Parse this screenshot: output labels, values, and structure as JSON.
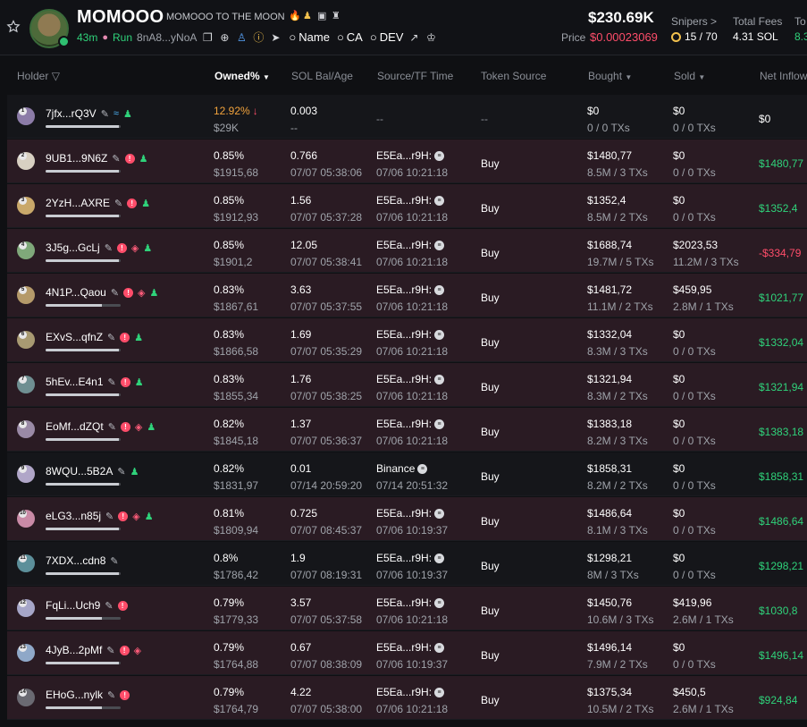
{
  "token": {
    "title": "MOMOOO",
    "subtitle": "MOMOOO TO THE MOON",
    "age": "43m",
    "run_label": "Run",
    "ca_short": "8nA8...yNoA",
    "links": {
      "name": "Name",
      "ca": "CA",
      "dev": "DEV"
    },
    "market_cap": "$230.69K",
    "price_label": "Price",
    "price_value": "$0.00023069",
    "snipers_label": "Snipers >",
    "snipers_value": "15 / 70",
    "fees_label": "Total Fees",
    "fees_value": "4.31 SOL",
    "to_label": "To",
    "to_value": "8.3"
  },
  "columns": {
    "holder": "Holder",
    "owned": "Owned%",
    "sol_bal": "SOL Bal/Age",
    "source": "Source/TF Time",
    "token_source": "Token Source",
    "bought": "Bought",
    "sold": "Sold",
    "net_inflow": "Net Inflow"
  },
  "rows": [
    {
      "rank": "1",
      "holder": "7jfx...rQ3V",
      "badges": [
        "swim",
        "user"
      ],
      "bar": 0.98,
      "owned": "12.92%",
      "owned_usd": "$29K",
      "sol": "0.003",
      "age": "--",
      "source": "--",
      "tf_time": "",
      "token_source": "--",
      "bought": "$0",
      "bought_tx": "0 / 0 TXs",
      "sold": "$0",
      "sold_tx": "0 / 0 TXs",
      "inflow": "$0",
      "style": "dark",
      "highlight": true
    },
    {
      "rank": "2",
      "holder": "9UB1...9N6Z",
      "badges": [
        "warn",
        "user"
      ],
      "bar": 0.98,
      "owned": "0.85%",
      "owned_usd": "$1915,68",
      "sol": "0.766",
      "age": "07/07 05:38:06",
      "source": "E5Ea...r9H:",
      "tf_time": "07/06 10:21:18",
      "token_source": "Buy",
      "bought": "$1480,77",
      "bought_tx": "8.5M / 3 TXs",
      "sold": "$0",
      "sold_tx": "0 / 0 TXs",
      "inflow": "$1480,77",
      "style": "pink"
    },
    {
      "rank": "3",
      "holder": "2YzH...AXRE",
      "badges": [
        "warn",
        "user"
      ],
      "bar": 0.98,
      "owned": "0.85%",
      "owned_usd": "$1912,93",
      "sol": "1.56",
      "age": "07/07 05:37:28",
      "source": "E5Ea...r9H:",
      "tf_time": "07/06 10:21:18",
      "token_source": "Buy",
      "bought": "$1352,4",
      "bought_tx": "8.5M / 2 TXs",
      "sold": "$0",
      "sold_tx": "0 / 0 TXs",
      "inflow": "$1352,4",
      "style": "pink"
    },
    {
      "rank": "4",
      "holder": "3J5g...GcLj",
      "badges": [
        "warn",
        "layer",
        "user"
      ],
      "bar": 0.98,
      "owned": "0.85%",
      "owned_usd": "$1901,2",
      "sol": "12.05",
      "age": "07/07 05:38:41",
      "source": "E5Ea...r9H:",
      "tf_time": "07/06 10:21:18",
      "token_source": "Buy",
      "bought": "$1688,74",
      "bought_tx": "19.7M / 5 TXs",
      "sold": "$2023,53",
      "sold_tx": "11.2M / 3 TXs",
      "inflow": "-$334,79",
      "style": "pink",
      "neg": true
    },
    {
      "rank": "5",
      "holder": "4N1P...Qaou",
      "badges": [
        "warn",
        "layer",
        "user"
      ],
      "bar": 0.75,
      "owned": "0.83%",
      "owned_usd": "$1867,61",
      "sol": "3.63",
      "age": "07/07 05:37:55",
      "source": "E5Ea...r9H:",
      "tf_time": "07/06 10:21:18",
      "token_source": "Buy",
      "bought": "$1481,72",
      "bought_tx": "11.1M / 2 TXs",
      "sold": "$459,95",
      "sold_tx": "2.8M / 1 TXs",
      "inflow": "$1021,77",
      "style": "pink"
    },
    {
      "rank": "6",
      "holder": "EXvS...qfnZ",
      "badges": [
        "warn",
        "user"
      ],
      "bar": 0.98,
      "owned": "0.83%",
      "owned_usd": "$1866,58",
      "sol": "1.69",
      "age": "07/07 05:35:29",
      "source": "E5Ea...r9H:",
      "tf_time": "07/06 10:21:18",
      "token_source": "Buy",
      "bought": "$1332,04",
      "bought_tx": "8.3M / 3 TXs",
      "sold": "$0",
      "sold_tx": "0 / 0 TXs",
      "inflow": "$1332,04",
      "style": "pink"
    },
    {
      "rank": "7",
      "holder": "5hEv...E4n1",
      "badges": [
        "warn",
        "user"
      ],
      "bar": 0.98,
      "owned": "0.83%",
      "owned_usd": "$1855,34",
      "sol": "1.76",
      "age": "07/07 05:38:25",
      "source": "E5Ea...r9H:",
      "tf_time": "07/06 10:21:18",
      "token_source": "Buy",
      "bought": "$1321,94",
      "bought_tx": "8.3M / 2 TXs",
      "sold": "$0",
      "sold_tx": "0 / 0 TXs",
      "inflow": "$1321,94",
      "style": "pink"
    },
    {
      "rank": "8",
      "holder": "EoMf...dZQt",
      "badges": [
        "warn",
        "layer",
        "user"
      ],
      "bar": 0.98,
      "owned": "0.82%",
      "owned_usd": "$1845,18",
      "sol": "1.37",
      "age": "07/07 05:36:37",
      "source": "E5Ea...r9H:",
      "tf_time": "07/06 10:21:18",
      "token_source": "Buy",
      "bought": "$1383,18",
      "bought_tx": "8.2M / 3 TXs",
      "sold": "$0",
      "sold_tx": "0 / 0 TXs",
      "inflow": "$1383,18",
      "style": "pink"
    },
    {
      "rank": "9",
      "holder": "8WQU...5B2A",
      "badges": [
        "user"
      ],
      "bar": 0.98,
      "owned": "0.82%",
      "owned_usd": "$1831,97",
      "sol": "0.01",
      "age": "07/14 20:59:20",
      "source": "Binance",
      "tf_time": "07/14 20:51:32",
      "token_source": "Buy",
      "bought": "$1858,31",
      "bought_tx": "8.2M / 2 TXs",
      "sold": "$0",
      "sold_tx": "0 / 0 TXs",
      "inflow": "$1858,31",
      "style": "dark"
    },
    {
      "rank": "10",
      "holder": "eLG3...n85j",
      "badges": [
        "warn",
        "layer",
        "user"
      ],
      "bar": 0.98,
      "owned": "0.81%",
      "owned_usd": "$1809,94",
      "sol": "0.725",
      "age": "07/07 08:45:37",
      "source": "E5Ea...r9H:",
      "tf_time": "07/06 10:19:37",
      "token_source": "Buy",
      "bought": "$1486,64",
      "bought_tx": "8.1M / 3 TXs",
      "sold": "$0",
      "sold_tx": "0 / 0 TXs",
      "inflow": "$1486,64",
      "style": "pink"
    },
    {
      "rank": "11",
      "holder": "7XDX...cdn8",
      "badges": [],
      "bar": 0.98,
      "owned": "0.8%",
      "owned_usd": "$1786,42",
      "sol": "1.9",
      "age": "07/07 08:19:31",
      "source": "E5Ea...r9H:",
      "tf_time": "07/06 10:19:37",
      "token_source": "Buy",
      "bought": "$1298,21",
      "bought_tx": "8M / 3 TXs",
      "sold": "$0",
      "sold_tx": "0 / 0 TXs",
      "inflow": "$1298,21",
      "style": "dark"
    },
    {
      "rank": "12",
      "holder": "FqLi...Uch9",
      "badges": [
        "warn"
      ],
      "bar": 0.75,
      "owned": "0.79%",
      "owned_usd": "$1779,33",
      "sol": "3.57",
      "age": "07/07 05:37:58",
      "source": "E5Ea...r9H:",
      "tf_time": "07/06 10:21:18",
      "token_source": "Buy",
      "bought": "$1450,76",
      "bought_tx": "10.6M / 3 TXs",
      "sold": "$419,96",
      "sold_tx": "2.6M / 1 TXs",
      "inflow": "$1030,8",
      "style": "pink"
    },
    {
      "rank": "13",
      "holder": "4JyB...2pMf",
      "badges": [
        "warn",
        "layer"
      ],
      "bar": 0.98,
      "owned": "0.79%",
      "owned_usd": "$1764,88",
      "sol": "0.67",
      "age": "07/07 08:38:09",
      "source": "E5Ea...r9H:",
      "tf_time": "07/06 10:19:37",
      "token_source": "Buy",
      "bought": "$1496,14",
      "bought_tx": "7.9M / 2 TXs",
      "sold": "$0",
      "sold_tx": "0 / 0 TXs",
      "inflow": "$1496,14",
      "style": "pink"
    },
    {
      "rank": "14",
      "holder": "EHoG...nylk",
      "badges": [
        "warn"
      ],
      "bar": 0.75,
      "owned": "0.79%",
      "owned_usd": "$1764,79",
      "sol": "4.22",
      "age": "07/07 05:38:00",
      "source": "E5Ea...r9H:",
      "tf_time": "07/06 10:21:18",
      "token_source": "Buy",
      "bought": "$1375,34",
      "bought_tx": "10.5M / 2 TXs",
      "sold": "$450,5",
      "sold_tx": "2.6M / 1 TXs",
      "inflow": "$924,84",
      "style": "pink"
    }
  ]
}
